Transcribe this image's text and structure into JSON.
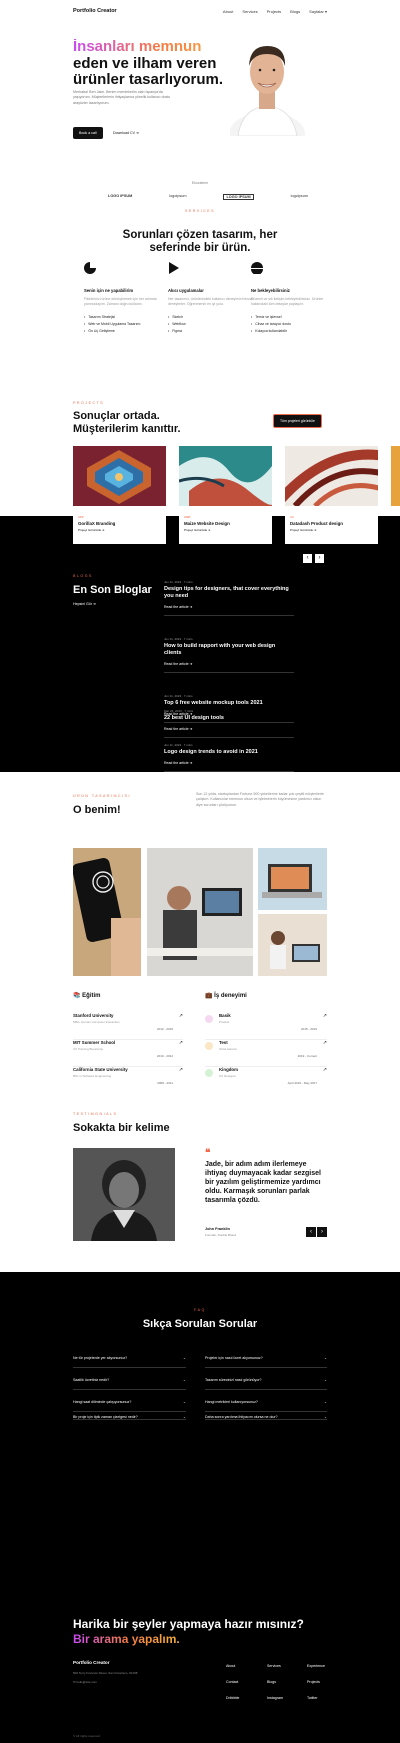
{
  "header": {
    "brand": "Portfolio Creator",
    "nav": [
      "About",
      "Services",
      "Projects",
      "Blogs",
      "Sayfalar"
    ]
  },
  "hero": {
    "title_line1": "İnsanları memnun",
    "title_line2": "eden ve ilham veren",
    "title_line3": "ürünler tasarlıyorum.",
    "lead": "Merhaba! Ben Jake. Benim memleketim olan İspanya'da yaşıyorum. Müşterilerimin ihtiyaçlarına yönelik kullanıcı dostu arayüzler tasarlıyorum.",
    "cta_primary": "Book a call",
    "cta_secondary": "Download CV"
  },
  "partners": {
    "title": "Ekosistem",
    "logos": [
      "LOGO IPSUM",
      "logoipsum",
      "LOGO IPSUM",
      "logoipsum"
    ]
  },
  "services": {
    "eyebrow": "SERVICES",
    "title_line1": "Sorunları çözen tasarım, her",
    "title_line2": "seferinde bir ürün.",
    "items": [
      {
        "title": "Senin için ne yapabilirim",
        "desc": "Fikirlerinizi ürüne dönüştürmek için her adımda yanınızdayım. Zamanı doğru kullanın.",
        "bullets": [
          "Tasarım Stratejisi",
          "Web ve Mobil Uygulama Tasarımı",
          "Ön Uç Geliştirme"
        ]
      },
      {
        "title": "Akıcı uygulamalar",
        "desc": "Her tasarımcı, ürünlerindeki kullanıcı deneyimini bizzat deneyimler. Öğrenmenin en iyi yolu.",
        "bullets": [
          "Sketch",
          "Webflow",
          "Figma"
        ]
      },
      {
        "title": "Ne bekleyebilirsiniz",
        "desc": "Düzenli ve sık iletişim bekleyebilirsiniz. Ürünler hakkındaki tüm detaylar paylaşılır.",
        "bullets": [
          "Temiz ve işlevsel",
          "Cihaz ve tarayıcı dostu",
          "Kolayca kullanılabilir"
        ]
      }
    ]
  },
  "projects": {
    "eyebrow": "PROJECTS",
    "title_line1": "Sonuçlar ortada.",
    "title_line2": "Müşterilerim kanıttır.",
    "button": "Tüm projeleri görüntüle",
    "cards": [
      {
        "tag": "APP",
        "title": "GorillaX Branding",
        "link": "Projeyi Görüntüle"
      },
      {
        "tag": "WEB",
        "title": "Maize Website Design",
        "link": "Projeyi Görüntüle"
      },
      {
        "tag": "UX",
        "title": "Datadash Product design",
        "link": "Projeyi Görüntüle"
      }
    ],
    "prev": "‹",
    "next": "›"
  },
  "blogs": {
    "eyebrow": "BLOGS",
    "title": "En Son Bloglar",
    "all_link": "Hepsini Gör",
    "read_more": "Read the article",
    "items": [
      {
        "meta": "Jun 11, 2023 · 7 mins",
        "title": "Design tips for designers, that cover everything you need"
      },
      {
        "meta": "Jun 11, 2023 · 7 mins",
        "title": "How to build rapport with your web design clients"
      },
      {
        "meta": "Jun 11, 2023 · 7 mins",
        "title": "Top 6 free website mockup tools 2021"
      },
      {
        "meta": "Jun 11, 2023 · 7 mins",
        "title": "Logo design trends to avoid in 2021"
      },
      {
        "meta": "Mar 26, 2023 · 7 mins",
        "title": "22 best UI design tools"
      }
    ]
  },
  "about": {
    "eyebrow": "ÜRÜN TASARIMCISI",
    "title": "O benim!",
    "desc": "Son 12 yılda, startuplardan Fortune 500 şirketlerine kadar çok çeşitli müşterilerle çalıştım. Kullanıcılar memnun olsun ve işletmelerin büyümesine yardımcı olsun diye sorunları çözüyorum."
  },
  "education": {
    "title": "Eğitim",
    "items": [
      {
        "name": "Stanford University",
        "sub": "MBA, Human Computer Interaction",
        "years": "2012 - 2015"
      },
      {
        "name": "MIT Summer School",
        "sub": "UX Training Bootcamp",
        "years": "2010 - 2012"
      },
      {
        "name": "California State University",
        "sub": "BSc in Software Engineering",
        "years": "2008 - 2011"
      }
    ]
  },
  "experience": {
    "title": "İş deneyimi",
    "items": [
      {
        "name": "Basik",
        "sub": "Product",
        "years": "2015 - 2019"
      },
      {
        "name": "Test",
        "sub": "Ortak tasarım",
        "years": "2019 - Current"
      },
      {
        "name": "Kingdom",
        "sub": "UX Designer",
        "years": "April 2016 - May 2017"
      }
    ]
  },
  "testimonials": {
    "eyebrow": "TESTIMONIALS",
    "title": "Sokakta bir kelime",
    "quote": "Jade, bir adım adım ilerlemeye ihtiyaç duymayacak kadar sezgisel bir yazılım geliştirmemize yardımcı oldu. Karmaşık sorunları parlak tasarımla çözdü.",
    "author": "John Franklin",
    "role": "Founder, Double Brand",
    "prev": "‹",
    "next": "›"
  },
  "faq": {
    "eyebrow": "FAQ",
    "title": "Sıkça Sorulan Sorular",
    "left": [
      "Ne tür projelerde yer alıyorsunuz?",
      "Saatlik ücretiniz nedir?",
      "Hangi saat diliminde çalışıyorsunuz?",
      "Bir proje için tipik zaman çizelgesi nedir?"
    ],
    "right": [
      "Projeler için nasıl ücret alıyorsunuz?",
      "Tasarım sürecinizi nasıl görünüyor?",
      "Hangi metrikleri kullanıyorsunuz?",
      "Daha sonra yardıma ihtiyacım olursa ne olur?"
    ]
  },
  "cta": {
    "line1": "Harika bir şeyler yapmaya hazır mısınız?",
    "line2": "Bir arama yapalım."
  },
  "footer": {
    "brand": "Portfolio Creator",
    "address": "500 Terry Francois Street, San Francisco, 94158",
    "email": "hello@site.com",
    "col1": [
      "About",
      "Contact",
      "Dribbble"
    ],
    "col2": [
      "Services",
      "Blogs",
      "Instagram"
    ],
    "col3": [
      "Experience",
      "Projects",
      "Twitter"
    ],
    "copyright": "© All rights reserved"
  }
}
